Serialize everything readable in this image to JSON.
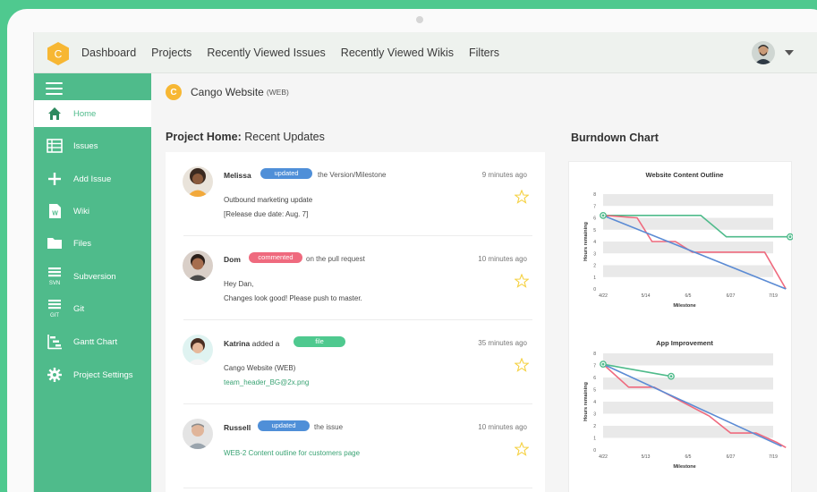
{
  "nav": {
    "logo_letter": "C",
    "items": [
      "Dashboard",
      "Projects",
      "Recently Viewed Issues",
      "Recently Viewed Wikis",
      "Filters"
    ]
  },
  "sidebar": {
    "items": [
      {
        "label": "Home",
        "icon": "home-icon"
      },
      {
        "label": "Issues",
        "icon": "list-icon"
      },
      {
        "label": "Add Issue",
        "icon": "plus-icon"
      },
      {
        "label": "Wiki",
        "icon": "wiki-icon"
      },
      {
        "label": "Files",
        "icon": "folder-icon"
      },
      {
        "label": "Subversion",
        "icon": "svn-icon"
      },
      {
        "label": "Git",
        "icon": "git-icon"
      },
      {
        "label": "Gantt Chart",
        "icon": "gantt-icon"
      },
      {
        "label": "Project Settings",
        "icon": "gear-icon"
      }
    ],
    "svn_sub": "SVN",
    "git_sub": "GIT"
  },
  "project": {
    "logo_letter": "C",
    "name": "Cango Website",
    "tag": "(WEB)"
  },
  "updates_section": {
    "title_bold": "Project Home:",
    "title_rest": "Recent Updates"
  },
  "updates": [
    {
      "name": "Melissa",
      "added": "",
      "badge": "updated",
      "badge_color": "#4f8fd8",
      "action": "the Version/Milestone",
      "time": "9 minutes ago",
      "line1": "Outbound marketing update",
      "line2": "[Release due date: Aug. 7]"
    },
    {
      "name": "Dom",
      "added": "",
      "badge": "commented",
      "badge_color": "#ef6a7e",
      "action": "on the pull request",
      "time": "10 minutes ago",
      "line1": "Hey Dan,",
      "line2": "Changes look good! Please push to master."
    },
    {
      "name": "Katrina",
      "added": "added a",
      "badge": "file",
      "badge_color": "#4fc98f",
      "action": "",
      "time": "35 minutes ago",
      "line1": "Cango Website (WEB)",
      "line2": "team_header_BG@2x.png"
    },
    {
      "name": "Russell",
      "added": "",
      "badge": "updated",
      "badge_color": "#4f8fd8",
      "action": "the issue",
      "time": "10 minutes ago",
      "line1": "WEB-2 Content outline for customers page",
      "line2": ""
    }
  ],
  "burndown_title": "Burndown Chart",
  "colors": {
    "green": "#4fbb8b",
    "blue": "#5b8bd4",
    "pink": "#ef6a7e",
    "star": "#f5d142"
  },
  "chart_data": [
    {
      "type": "line",
      "title": "Website Content Outline",
      "xlabel": "Milestone",
      "ylabel": "Hours remaining",
      "x": [
        "4/22",
        "5/14",
        "6/5",
        "6/27",
        "7/19"
      ],
      "ylim": [
        0,
        8
      ],
      "yticks": [
        0,
        1,
        2,
        3,
        4,
        5,
        6,
        7,
        8
      ],
      "series": [
        {
          "color": "#4fbb8b",
          "points": [
            [
              0,
              6.2
            ],
            [
              2.3,
              6.2
            ],
            [
              2.9,
              4.4
            ],
            [
              4.4,
              4.4
            ]
          ]
        },
        {
          "color": "#ef6a7e",
          "points": [
            [
              0,
              6.2
            ],
            [
              0.8,
              6.0
            ],
            [
              1.15,
              4.0
            ],
            [
              1.7,
              4.0
            ],
            [
              2.1,
              3.1
            ],
            [
              3.8,
              3.1
            ],
            [
              4.3,
              0
            ]
          ]
        },
        {
          "color": "#5b8bd4",
          "points": [
            [
              0,
              6.2
            ],
            [
              4.3,
              0
            ]
          ]
        }
      ]
    },
    {
      "type": "line",
      "title": "App Improvement",
      "xlabel": "Milestone",
      "ylabel": "Hours remaining",
      "x": [
        "4/22",
        "5/13",
        "6/5",
        "6/27",
        "7/19"
      ],
      "ylim": [
        0,
        8
      ],
      "yticks": [
        0,
        1,
        2,
        3,
        4,
        5,
        6,
        7,
        8
      ],
      "series": [
        {
          "color": "#4fbb8b",
          "points": [
            [
              0,
              7.1
            ],
            [
              1.6,
              6.1
            ]
          ]
        },
        {
          "color": "#ef6a7e",
          "points": [
            [
              0,
              7.1
            ],
            [
              0.6,
              5.2
            ],
            [
              1.2,
              5.2
            ],
            [
              2.5,
              2.8
            ],
            [
              3.0,
              1.4
            ],
            [
              3.6,
              1.4
            ],
            [
              4.1,
              0.6
            ],
            [
              4.3,
              0.2
            ]
          ]
        },
        {
          "color": "#5b8bd4",
          "points": [
            [
              0,
              7.1
            ],
            [
              4.2,
              0.3
            ]
          ]
        }
      ]
    }
  ]
}
